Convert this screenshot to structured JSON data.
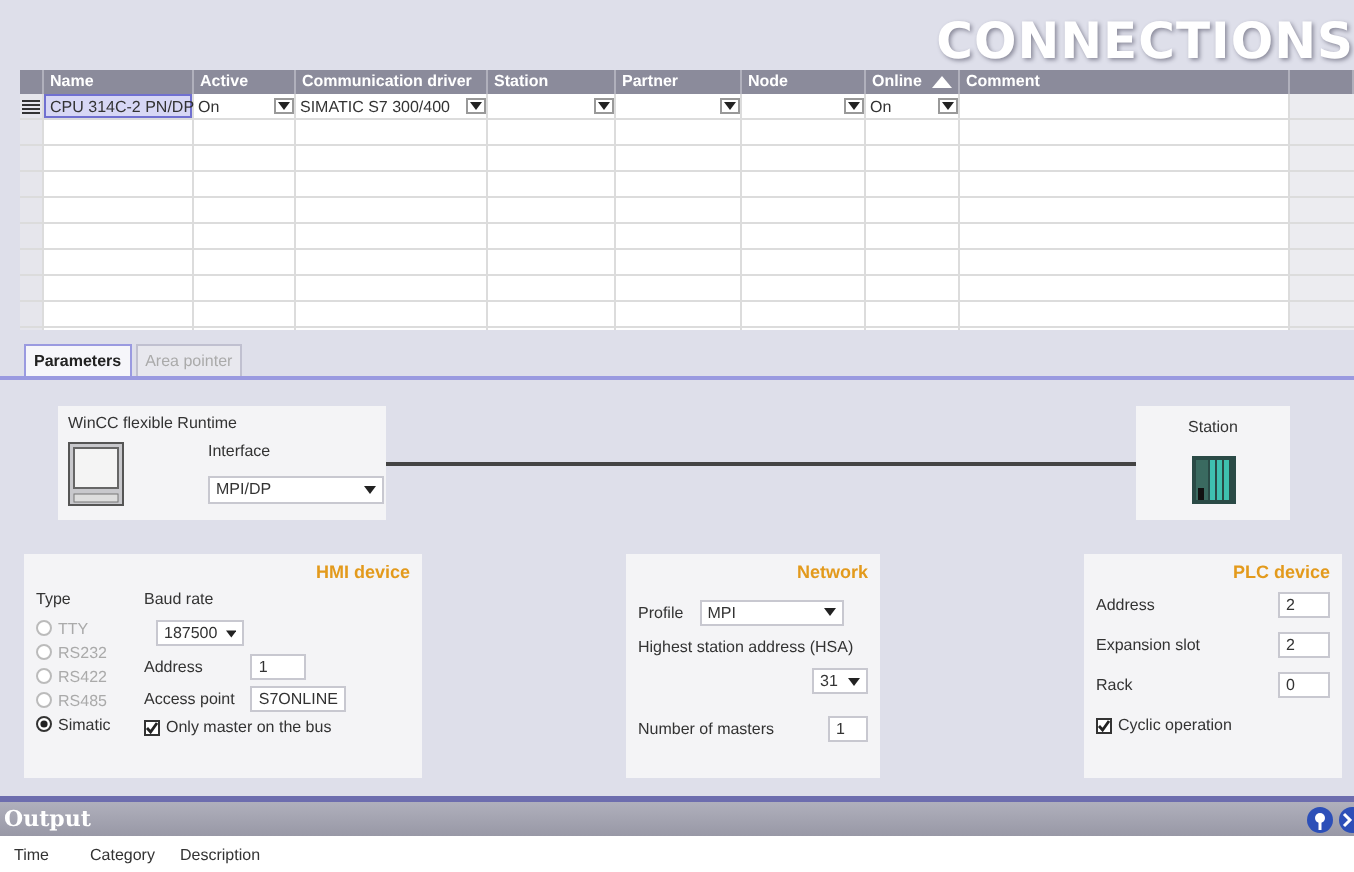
{
  "header": {
    "title": "CONNECTIONS"
  },
  "table": {
    "columns": [
      {
        "label": "Name"
      },
      {
        "label": "Active"
      },
      {
        "label": "Communication driver"
      },
      {
        "label": "Station"
      },
      {
        "label": "Partner"
      },
      {
        "label": "Node"
      },
      {
        "label": "Online",
        "sorted": true
      },
      {
        "label": "Comment"
      }
    ],
    "rows": [
      {
        "cells": [
          {
            "kind": "text",
            "text": "CPU 314C-2 PN/DP",
            "selected": true
          },
          {
            "kind": "dropdown",
            "text": "On"
          },
          {
            "kind": "dropdown",
            "text": "SIMATIC S7 300/400"
          },
          {
            "kind": "dropdown"
          },
          {
            "kind": "dropdown"
          },
          {
            "kind": "dropdown"
          },
          {
            "kind": "dropdown",
            "text": "On"
          }
        ]
      }
    ]
  },
  "tabs": [
    {
      "label": "Parameters",
      "selected": true
    },
    {
      "label": "Area pointer",
      "selected": false
    }
  ],
  "runtime": {
    "title": "WinCC flexible Runtime",
    "interface_label": "Interface",
    "interface": "MPI/DP"
  },
  "station": {
    "title": "Station"
  },
  "hmi_device": {
    "title": "HMI device",
    "type_label": "Type",
    "types": [
      {
        "label": "TTY",
        "selected": false,
        "disabled": true
      },
      {
        "label": "RS232",
        "selected": false,
        "disabled": true
      },
      {
        "label": "RS422",
        "selected": false,
        "disabled": true
      },
      {
        "label": "RS485",
        "selected": false,
        "disabled": true
      },
      {
        "label": "Simatic",
        "selected": true,
        "disabled": false
      }
    ],
    "baud_rate_label": "Baud rate",
    "baud_rate": "187500",
    "address_label": "Address",
    "address": "1",
    "access_point_label": "Access point",
    "access_point": "S7ONLINE",
    "only_master": {
      "label": "Only master on the bus",
      "checked": true
    }
  },
  "network": {
    "title": "Network",
    "profile_label": "Profile",
    "profile": "MPI",
    "hsa_label": "Highest station address (HSA)",
    "hsa": "31",
    "masters_label": "Number of masters",
    "masters": "1"
  },
  "plc_device": {
    "title": "PLC device",
    "fields": [
      {
        "label": "Address",
        "value": "2"
      },
      {
        "label": "Expansion slot",
        "value": "2"
      },
      {
        "label": "Rack",
        "value": "0"
      }
    ],
    "cyclic": {
      "label": "Cyclic operation",
      "checked": true
    }
  },
  "output": {
    "title": "Output",
    "columns": [
      {
        "label": "Time"
      },
      {
        "label": "Category"
      },
      {
        "label": "Description"
      }
    ]
  }
}
